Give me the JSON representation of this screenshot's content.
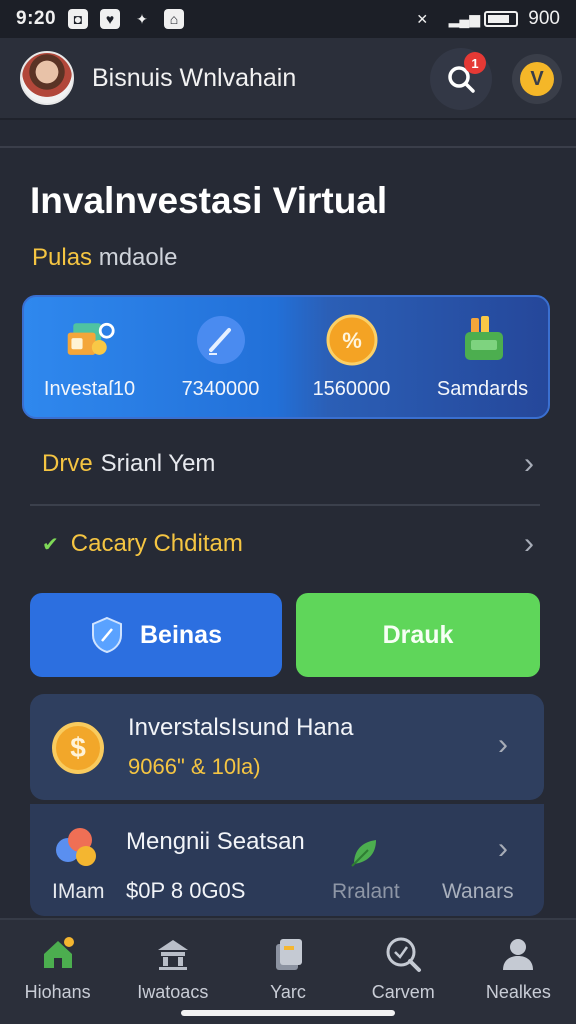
{
  "status_bar": {
    "time": "9:20",
    "battery": "900"
  },
  "header": {
    "app_title": "Bisnuis Wnlvahain",
    "notification_count": "1"
  },
  "page": {
    "title": "Invalnvestasi Virtual",
    "subtitle_accent": "Pulas",
    "subtitle_rest": "mdaole"
  },
  "stats": [
    {
      "label": "Investaſ10",
      "icon": "wallet-icon"
    },
    {
      "label": "7340000",
      "icon": "pen-icon"
    },
    {
      "label": "1560000",
      "icon": "coin-icon"
    },
    {
      "label": "Samdards",
      "icon": "cash-icon"
    }
  ],
  "rows": {
    "row1_accent": "Drve",
    "row1_label": "Srianl Yem",
    "row2_label": "Cacary Chditam"
  },
  "buttons": {
    "primary": "Beinas",
    "secondary": "Drauk"
  },
  "cards": {
    "c1_title": "InverstalsIsund Hana",
    "c1_value": "9066\" & 10la)",
    "c2_title": "Mengnii Seatsan",
    "c2_left_label": "IMam",
    "c2_value": "$0P 8 0G0S",
    "c2_mid_label": "Rralant",
    "c2_right_label": "Wanars"
  },
  "bottom_nav": [
    {
      "label": "Hiohans",
      "icon": "home-icon"
    },
    {
      "label": "Iwatoacs",
      "icon": "bank-icon"
    },
    {
      "label": "Yarc",
      "icon": "cards-icon"
    },
    {
      "label": "Carvem",
      "icon": "magnifier-icon"
    },
    {
      "label": "Nealkes",
      "icon": "profile-icon"
    }
  ],
  "colors": {
    "accent_yellow": "#f5c542",
    "primary_blue": "#2c6fe0",
    "success_green": "#5fd65a",
    "background": "#262a35"
  }
}
